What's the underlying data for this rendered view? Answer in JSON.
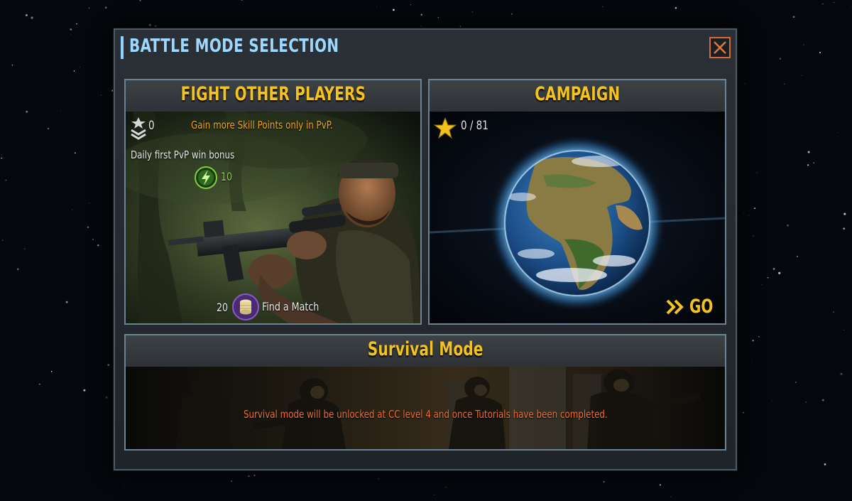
{
  "dialog": {
    "title": "BATTLE MODE SELECTION"
  },
  "pvp": {
    "title": "FIGHT OTHER PLAYERS",
    "rank_value": "0",
    "skill_hint": "Gain more Skill Points only in PvP.",
    "daily_bonus_label": "Daily first PvP win bonus",
    "energy_value": "10",
    "match_cost": "20",
    "find_match_label": "Find a Match"
  },
  "campaign": {
    "title": "CAMPAIGN",
    "progress": "0 / 81",
    "go_label": "GO"
  },
  "survival": {
    "title": "Survival Mode",
    "notice": "Survival mode will be unlocked at CC level 4 and once Tutorials have been completed."
  },
  "colors": {
    "title_blue": "#9fd8ff",
    "header_gold": "#f4c31e",
    "hint_orange": "#f0a31c",
    "notice_orange": "#f06a2e",
    "energy_green": "#8fd13a",
    "close_orange": "#d46a35"
  },
  "icons": {
    "close": "close-icon",
    "rank": "rank-chevron-icon",
    "energy": "energy-bolt-icon",
    "coin": "coin-stack-icon",
    "star": "star-icon",
    "go": "double-chevron-icon"
  }
}
